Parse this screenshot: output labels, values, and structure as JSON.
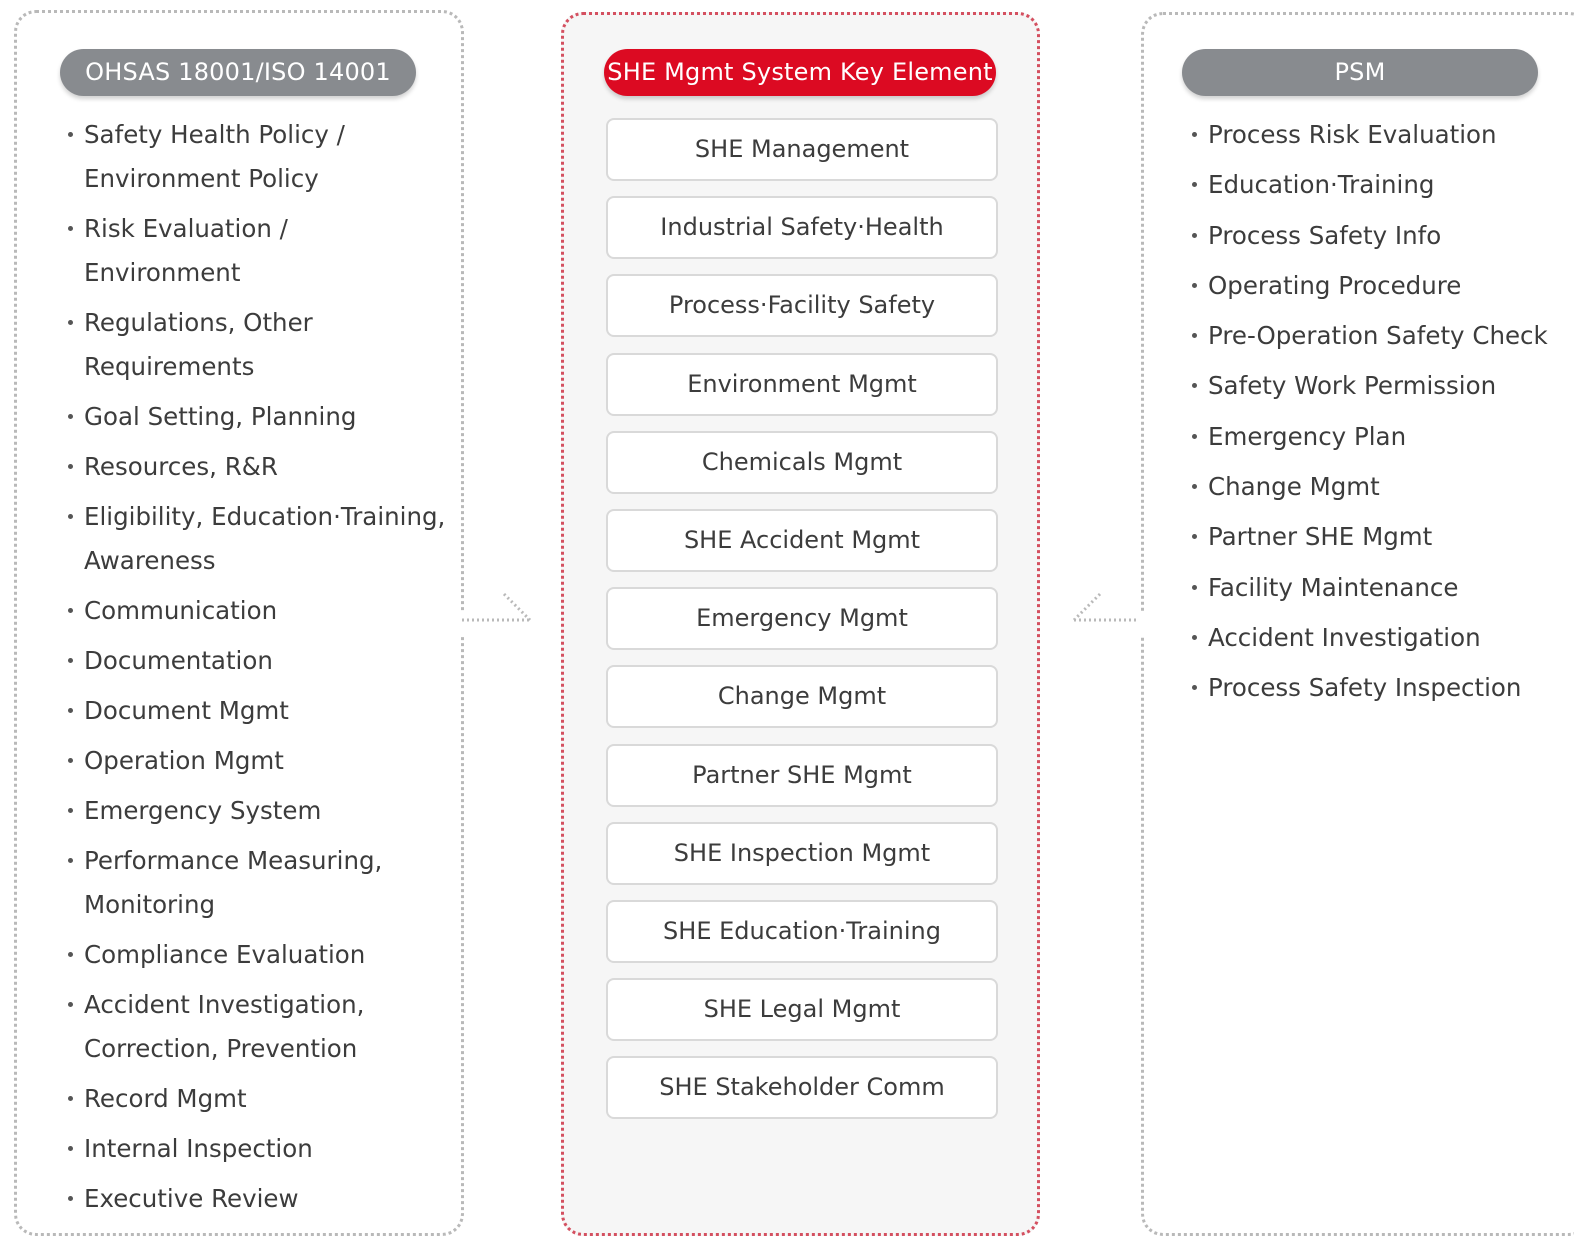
{
  "left_panel": {
    "title": "OHSAS 18001/ISO 14001",
    "items": [
      [
        "Safety Health Policy /",
        "Environment Policy"
      ],
      [
        "Risk Evaluation /",
        "Environment"
      ],
      [
        "Regulations, Other",
        "Requirements"
      ],
      [
        "Goal Setting, Planning"
      ],
      [
        "Resources, R&R"
      ],
      [
        "Eligibility, Education·Training,",
        "Awareness"
      ],
      [
        "Communication"
      ],
      [
        "Documentation"
      ],
      [
        "Document Mgmt"
      ],
      [
        "Operation Mgmt"
      ],
      [
        "Emergency System"
      ],
      [
        "Performance Measuring,",
        "Monitoring"
      ],
      [
        "Compliance Evaluation"
      ],
      [
        "Accident Investigation,",
        "Correction, Prevention"
      ],
      [
        "Record Mgmt"
      ],
      [
        "Internal Inspection"
      ],
      [
        "Executive Review"
      ]
    ]
  },
  "center_panel": {
    "title": "SHE Mgmt System Key Element",
    "items": [
      "SHE Management",
      "Industrial Safety·Health",
      "Process·Facility Safety",
      "Environment Mgmt",
      "Chemicals Mgmt",
      "SHE Accident Mgmt",
      "Emergency Mgmt",
      "Change Mgmt",
      "Partner SHE Mgmt",
      "SHE Inspection Mgmt",
      "SHE Education·Training",
      "SHE Legal Mgmt",
      "SHE Stakeholder Comm"
    ]
  },
  "right_panel": {
    "title": "PSM",
    "items": [
      "Process Risk Evaluation",
      "Education·Training",
      "Process Safety Info",
      "Operating Procedure",
      "Pre-Operation Safety Check",
      "Safety Work Permission",
      "Emergency Plan",
      "Change Mgmt",
      "Partner SHE Mgmt",
      "Facility Maintenance",
      "Accident Investigation",
      "Process Safety Inspection"
    ]
  },
  "colors": {
    "accent_red": "#dc0a22",
    "pill_gray": "#888b8f",
    "dotted_gray": "#b9b9b9",
    "center_bg": "#f6f6f6"
  },
  "icons": {
    "left_connector": "dotted-arrow-right-icon",
    "right_connector": "dotted-arrow-left-icon"
  }
}
